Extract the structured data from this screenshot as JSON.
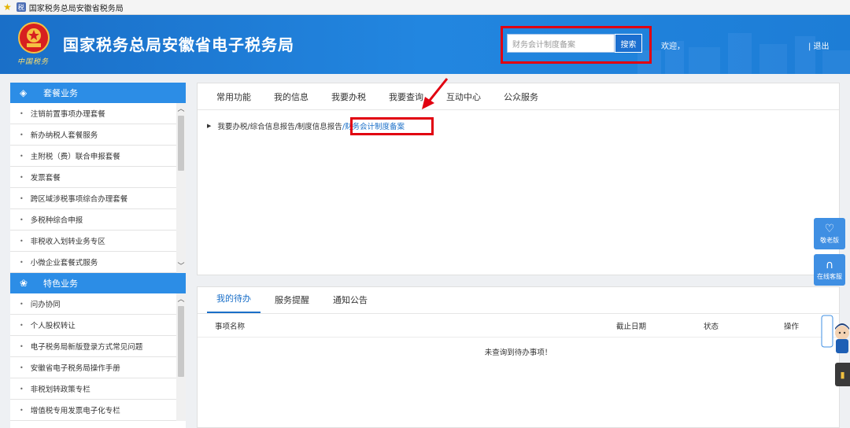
{
  "browser": {
    "tab_title": "国家税务总局安徽省税务局"
  },
  "header": {
    "emblem_text": "中国税务",
    "site_title": "国家税务总局安徽省电子税务局",
    "search": {
      "value": "财务会计制度备案",
      "button_label": "搜索"
    },
    "welcome": "欢迎，",
    "logout": "| 退出"
  },
  "sidebar": {
    "section1": {
      "title": "套餐业务",
      "items": [
        "注销前置事项办理套餐",
        "新办纳税人套餐服务",
        "主附税（费）联合申报套餐",
        "发票套餐",
        "跨区域涉税事项综合办理套餐",
        "多税种综合申报",
        "非税收入划转业务专区",
        "小微企业套餐式服务"
      ]
    },
    "section2": {
      "title": "特色业务",
      "items": [
        "问办协同",
        "个人股权转让",
        "电子税务局新版登录方式常见问题",
        "安徽省电子税务局操作手册",
        "非税划转政策专栏",
        "增值税专用发票电子化专栏"
      ]
    }
  },
  "main": {
    "tabs": [
      "常用功能",
      "我的信息",
      "我要办税",
      "我要查询",
      "互动中心",
      "公众服务"
    ],
    "breadcrumb": {
      "parts": [
        "我要办税",
        "/综合信息报告",
        "/制度信息报告",
        "/财务会计制度备案"
      ]
    }
  },
  "todo": {
    "tabs": [
      "我的待办",
      "服务提醒",
      "通知公告"
    ],
    "columns": [
      "事项名称",
      "截止日期",
      "状态",
      "操作"
    ],
    "empty_message": "未查询到待办事项！"
  },
  "floating": {
    "elder_label": "敬老版",
    "service_label": "在线客服"
  },
  "colors": {
    "header_blue": "#1d7dd6",
    "sidebar_head": "#2c8de6",
    "highlight_red": "#e10010",
    "link_blue": "#1a6fc8"
  }
}
